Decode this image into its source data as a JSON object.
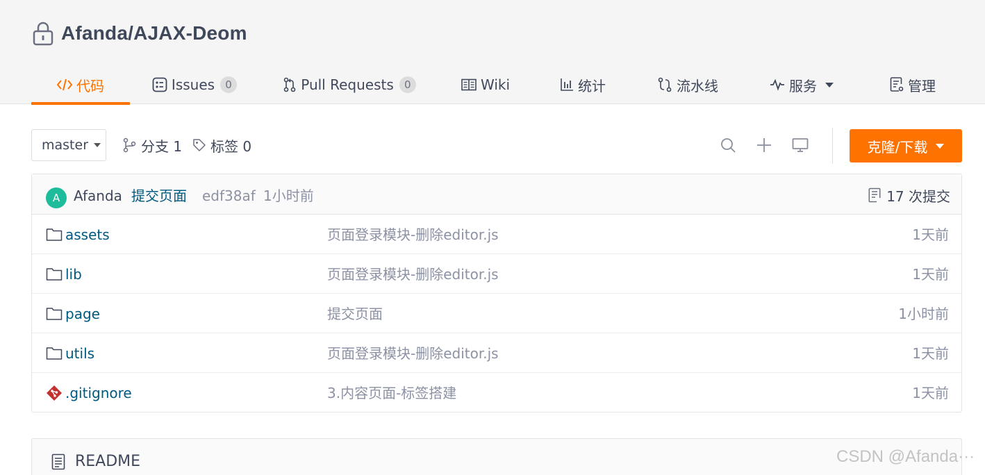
{
  "repo": {
    "title": "Afanda/AJAX-Deom"
  },
  "tabs": [
    {
      "label": "代码",
      "icon": "code-icon",
      "active": true
    },
    {
      "label": "Issues",
      "icon": "issues-icon",
      "badge": "0"
    },
    {
      "label": "Pull Requests",
      "icon": "pull-request-icon",
      "badge": "0"
    },
    {
      "label": "Wiki",
      "icon": "book-icon"
    },
    {
      "label": "统计",
      "icon": "bar-chart-icon"
    },
    {
      "label": "流水线",
      "icon": "pipeline-icon"
    },
    {
      "label": "服务",
      "icon": "pulse-icon",
      "dropdown": true
    },
    {
      "label": "管理",
      "icon": "settings-doc-icon"
    }
  ],
  "toolbar": {
    "branch": "master",
    "branches_label": "分支 1",
    "tags_label": "标签 0",
    "clone_label": "克隆/下载"
  },
  "commit": {
    "avatar_letter": "A",
    "author": "Afanda",
    "message": "提交页面",
    "sha": "edf38af",
    "time": "1小时前",
    "count_label": "17 次提交"
  },
  "files": [
    {
      "name": "assets",
      "type": "folder",
      "message": "页面登录模块-删除editor.js",
      "time": "1天前"
    },
    {
      "name": "lib",
      "type": "folder",
      "message": "页面登录模块-删除editor.js",
      "time": "1天前"
    },
    {
      "name": "page",
      "type": "folder",
      "message": "提交页面",
      "time": "1小时前"
    },
    {
      "name": "utils",
      "type": "folder",
      "message": "页面登录模块-删除editor.js",
      "time": "1天前"
    },
    {
      "name": ".gitignore",
      "type": "git-file",
      "message": "3.内容页面-标签搭建",
      "time": "1天前"
    }
  ],
  "readme": {
    "title": "README"
  },
  "watermark": "CSDN @Afanda···",
  "colors": {
    "accent": "#fe7300",
    "link": "#005980",
    "muted": "#8c92a4",
    "avatar": "#1fbc9c"
  }
}
